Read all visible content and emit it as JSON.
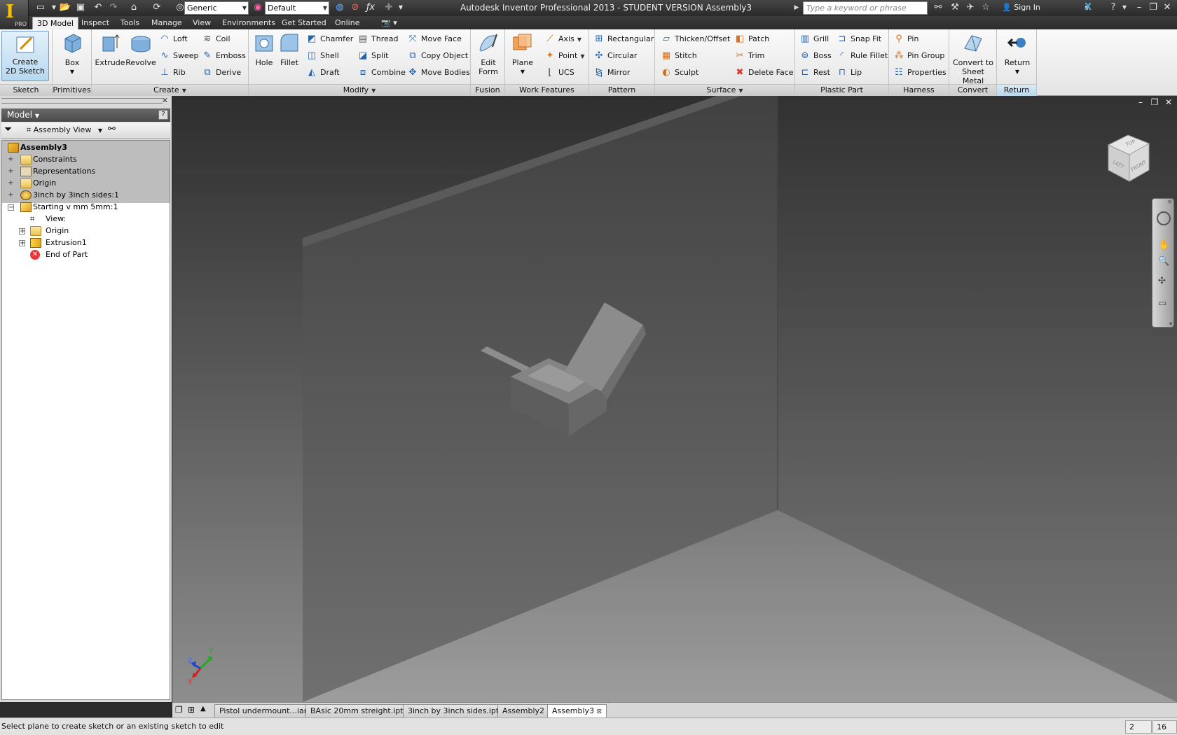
{
  "title_bar": {
    "app_title": "Autodesk Inventor Professional 2013 - STUDENT VERSION   Assembly3",
    "app_badge": "PRO",
    "material_combo": "Generic",
    "appearance_combo": "Default",
    "search_placeholder": "Type a keyword or phrase",
    "sign_in": "Sign In"
  },
  "tabs": [
    "3D Model",
    "Inspect",
    "Tools",
    "Manage",
    "View",
    "Environments",
    "Get Started",
    "Online"
  ],
  "active_tab": "3D Model",
  "ribbon": {
    "sketch": {
      "label": "Sketch",
      "create_2d_sketch": "Create\n2D Sketch"
    },
    "primitives": {
      "label": "Primitives",
      "box": "Box"
    },
    "create": {
      "label": "Create",
      "extrude": "Extrude",
      "revolve": "Revolve",
      "loft": "Loft",
      "sweep": "Sweep",
      "rib": "Rib",
      "coil": "Coil",
      "emboss": "Emboss",
      "derive": "Derive"
    },
    "modify": {
      "label": "Modify",
      "hole": "Hole",
      "fillet": "Fillet",
      "chamfer": "Chamfer",
      "shell": "Shell",
      "draft": "Draft",
      "thread": "Thread",
      "split": "Split",
      "combine": "Combine",
      "move_face": "Move Face",
      "copy_object": "Copy Object",
      "move_bodies": "Move Bodies"
    },
    "fusion": {
      "label": "Fusion",
      "edit_form": "Edit\nForm"
    },
    "work_features": {
      "label": "Work Features",
      "plane": "Plane",
      "axis": "Axis",
      "point": "Point",
      "ucs": "UCS"
    },
    "pattern": {
      "label": "Pattern",
      "rectangular": "Rectangular",
      "circular": "Circular",
      "mirror": "Mirror"
    },
    "surface": {
      "label": "Surface",
      "thicken_offset": "Thicken/Offset",
      "stitch": "Stitch",
      "sculpt": "Sculpt",
      "patch": "Patch",
      "trim": "Trim",
      "delete_face": "Delete Face"
    },
    "plastic_part": {
      "label": "Plastic Part",
      "grill": "Grill",
      "boss": "Boss",
      "rest": "Rest",
      "snap_fit": "Snap Fit",
      "rule_fillet": "Rule Fillet",
      "lip": "Lip"
    },
    "harness": {
      "label": "Harness",
      "pin": "Pin",
      "pin_group": "Pin Group",
      "properties": "Properties"
    },
    "convert": {
      "label": "Convert",
      "convert_to_sheet_metal": "Convert to\nSheet Metal"
    },
    "return": {
      "label": "Return",
      "return": "Return"
    }
  },
  "browser": {
    "header": "Model",
    "view_combo": "Assembly View",
    "tree": [
      {
        "label": "Assembly3",
        "level": 0,
        "bold": true
      },
      {
        "label": "Constraints",
        "level": 1
      },
      {
        "label": "Representations",
        "level": 1
      },
      {
        "label": "Origin",
        "level": 1
      },
      {
        "label": "3inch by 3inch sides:1",
        "level": 1
      },
      {
        "label": "Starting v mm 5mm:1",
        "level": 1
      },
      {
        "label": "View:",
        "level": 2
      },
      {
        "label": "Origin",
        "level": 2
      },
      {
        "label": "Extrusion1",
        "level": 2
      },
      {
        "label": "End of Part",
        "level": 2
      }
    ]
  },
  "viewcube": {
    "top": "TOP",
    "left": "LEFT",
    "front": "FRONT"
  },
  "axes": {
    "x": "X",
    "y": "Y",
    "z": "Z"
  },
  "doc_tabs": [
    "Pistol undermount...iam",
    "BAsic 20mm streight.ipt",
    "3inch by 3inch sides.ipt",
    "Assembly2",
    "Assembly3"
  ],
  "active_doc": "Assembly3",
  "status": {
    "message": "Select plane to create sketch or an existing sketch to edit",
    "cell1": "2",
    "cell2": "16"
  }
}
